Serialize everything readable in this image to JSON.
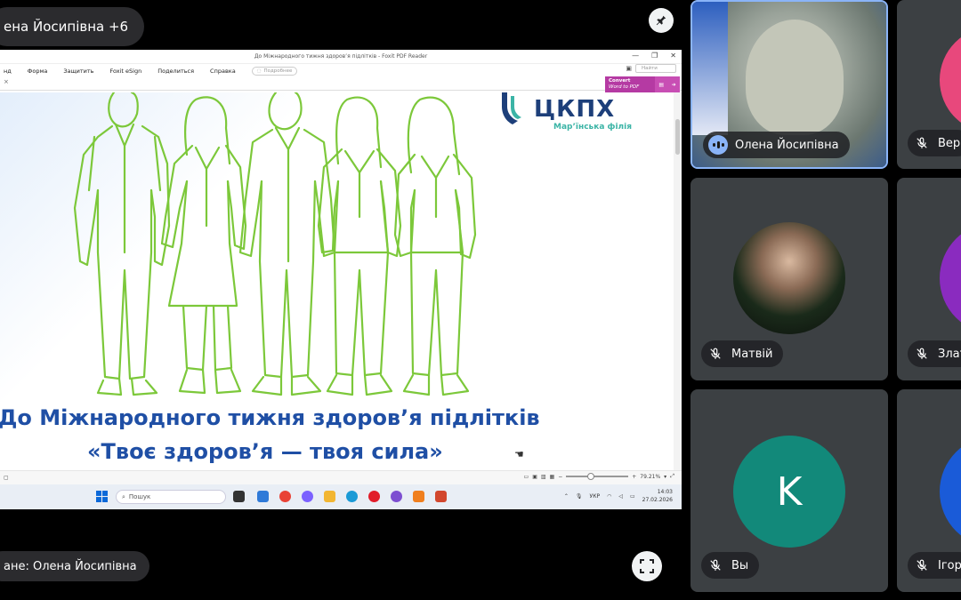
{
  "meeting": {
    "presenter_chip": "ена Йосипівна +6",
    "presenting_label": "ане: Олена Йосипівна"
  },
  "pdf_app": {
    "window_title": "До Міжнародного тижня здоров’я підлітків - Foxit PDF Reader",
    "menu": [
      "нд",
      "Форма",
      "Защитить",
      "Foxit eSign",
      "Поделиться",
      "Справка"
    ],
    "help_search_placeholder": "Подробнее",
    "find_placeholder": "Найти",
    "convert_banner_title": "Convert",
    "convert_banner_sub": "Word to PDF",
    "zoom": "79.21%"
  },
  "slide": {
    "logo_text": "ЦКПХ",
    "logo_sub": "Мар’їнська філія",
    "title_line1": "До Міжнародного тижня здоров’я підлітків",
    "title_line2": "«Твоє здоров’я — твоя сила»",
    "illustration_color": "#7cc83a",
    "title_color": "#1f4fa5"
  },
  "taskbar": {
    "search_label": "Пошук",
    "lang": "УКР",
    "time": "14:03",
    "date": "27.02.2026"
  },
  "participants": [
    {
      "name": "Олена Йосипівна",
      "speaking": true
    },
    {
      "name": "Вер"
    },
    {
      "name": "Матвій"
    },
    {
      "name": "Злат"
    },
    {
      "name": "Вы",
      "initial": "K"
    },
    {
      "name": "Ігор"
    }
  ],
  "colors": {
    "tile_bg": "#3c4043",
    "active_border": "#8ab4f8",
    "k_avatar": "#12897a",
    "pink_avatar": "#e8487c",
    "purple_avatar": "#8a2bbf",
    "blue_avatar": "#1a5bd8"
  }
}
